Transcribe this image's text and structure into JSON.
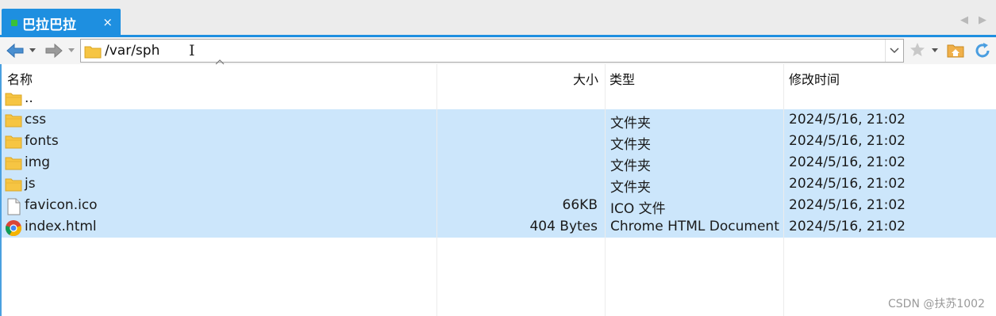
{
  "tab": {
    "title": "巴拉巴拉",
    "close": "×"
  },
  "tabnav": {
    "prev": "◀",
    "next": "▶"
  },
  "address": {
    "path": "/var/sph"
  },
  "columns": {
    "name": "名称",
    "size": "大小",
    "type": "类型",
    "modified": "修改时间"
  },
  "files": [
    {
      "name": "..",
      "size": "",
      "type": "",
      "modified": "",
      "icon": "folder-icon",
      "selected": false
    },
    {
      "name": "css",
      "size": "",
      "type": "文件夹",
      "modified": "2024/5/16, 21:02",
      "icon": "folder-icon",
      "selected": true
    },
    {
      "name": "fonts",
      "size": "",
      "type": "文件夹",
      "modified": "2024/5/16, 21:02",
      "icon": "folder-icon",
      "selected": true
    },
    {
      "name": "img",
      "size": "",
      "type": "文件夹",
      "modified": "2024/5/16, 21:02",
      "icon": "folder-icon",
      "selected": true
    },
    {
      "name": "js",
      "size": "",
      "type": "文件夹",
      "modified": "2024/5/16, 21:02",
      "icon": "folder-icon",
      "selected": true
    },
    {
      "name": "favicon.ico",
      "size": "66KB",
      "type": "ICO 文件",
      "modified": "2024/5/16, 21:02",
      "icon": "file-icon",
      "selected": true
    },
    {
      "name": "index.html",
      "size": "404 Bytes",
      "type": "Chrome HTML Document",
      "modified": "2024/5/16, 21:02",
      "icon": "chrome-icon",
      "selected": true
    }
  ],
  "watermark": "CSDN @扶苏1002",
  "colors": {
    "accent": "#1e8fe0",
    "selection": "#cce6fb",
    "folder": "#f6c543"
  }
}
